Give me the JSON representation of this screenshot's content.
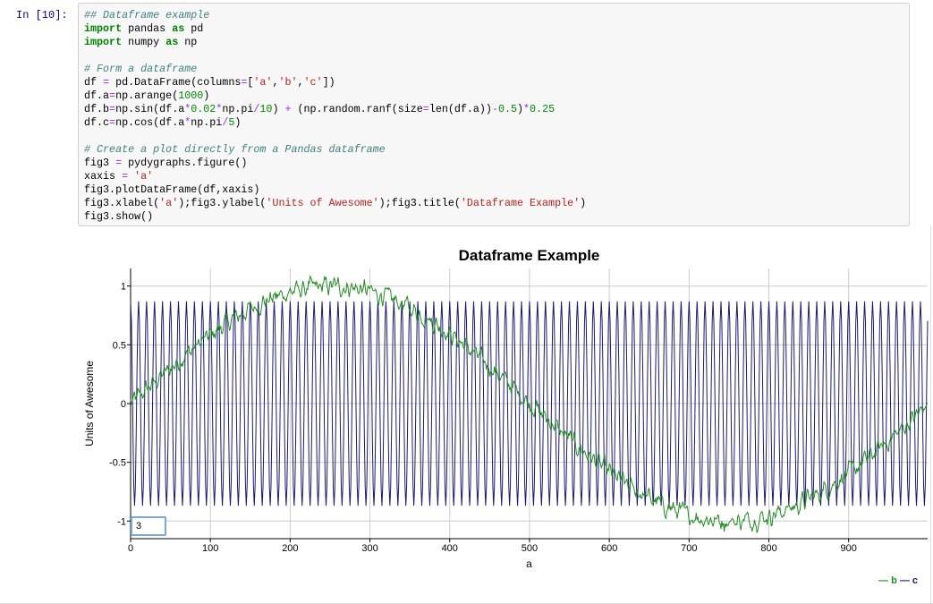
{
  "cell": {
    "prompt": "In [10]:",
    "code_lines": [
      [
        {
          "t": "## Dataframe example",
          "c": "comment"
        }
      ],
      [
        {
          "t": "import",
          "c": "kw"
        },
        {
          "t": " pandas ",
          "c": ""
        },
        {
          "t": "as",
          "c": "kw"
        },
        {
          "t": " pd",
          "c": ""
        }
      ],
      [
        {
          "t": "import",
          "c": "kw"
        },
        {
          "t": " numpy ",
          "c": ""
        },
        {
          "t": "as",
          "c": "kw"
        },
        {
          "t": " np",
          "c": ""
        }
      ],
      [
        {
          "t": "",
          "c": ""
        }
      ],
      [
        {
          "t": "# Form a dataframe",
          "c": "comment"
        }
      ],
      [
        {
          "t": "df ",
          "c": ""
        },
        {
          "t": "=",
          "c": "op"
        },
        {
          "t": " pd.DataFrame(columns",
          "c": ""
        },
        {
          "t": "=",
          "c": "op"
        },
        {
          "t": "[",
          "c": ""
        },
        {
          "t": "'a'",
          "c": "str"
        },
        {
          "t": ",",
          "c": ""
        },
        {
          "t": "'b'",
          "c": "str"
        },
        {
          "t": ",",
          "c": ""
        },
        {
          "t": "'c'",
          "c": "str"
        },
        {
          "t": "])",
          "c": ""
        }
      ],
      [
        {
          "t": "df.a",
          "c": ""
        },
        {
          "t": "=",
          "c": "op"
        },
        {
          "t": "np.arange(",
          "c": ""
        },
        {
          "t": "1000",
          "c": "num"
        },
        {
          "t": ")",
          "c": ""
        }
      ],
      [
        {
          "t": "df.b",
          "c": ""
        },
        {
          "t": "=",
          "c": "op"
        },
        {
          "t": "np.sin(df.a",
          "c": ""
        },
        {
          "t": "*",
          "c": "op"
        },
        {
          "t": "0.02",
          "c": "num"
        },
        {
          "t": "*",
          "c": "op"
        },
        {
          "t": "np.pi",
          "c": ""
        },
        {
          "t": "/",
          "c": "op"
        },
        {
          "t": "10",
          "c": "num"
        },
        {
          "t": ") ",
          "c": ""
        },
        {
          "t": "+",
          "c": "op"
        },
        {
          "t": " (np.random.ranf(size",
          "c": ""
        },
        {
          "t": "=",
          "c": "op"
        },
        {
          "t": "len(df.a))",
          "c": ""
        },
        {
          "t": "-",
          "c": "op"
        },
        {
          "t": "0.5",
          "c": "num"
        },
        {
          "t": ")",
          "c": ""
        },
        {
          "t": "*",
          "c": "op"
        },
        {
          "t": "0.25",
          "c": "num"
        }
      ],
      [
        {
          "t": "df.c",
          "c": ""
        },
        {
          "t": "=",
          "c": "op"
        },
        {
          "t": "np.cos(df.a",
          "c": ""
        },
        {
          "t": "*",
          "c": "op"
        },
        {
          "t": "np.pi",
          "c": ""
        },
        {
          "t": "/",
          "c": "op"
        },
        {
          "t": "5",
          "c": "num"
        },
        {
          "t": ")",
          "c": ""
        }
      ],
      [
        {
          "t": "",
          "c": ""
        }
      ],
      [
        {
          "t": "# Create a plot directly from a Pandas dataframe",
          "c": "comment"
        }
      ],
      [
        {
          "t": "fig3 ",
          "c": ""
        },
        {
          "t": "=",
          "c": "op"
        },
        {
          "t": " pydygraphs.figure()",
          "c": ""
        }
      ],
      [
        {
          "t": "xaxis ",
          "c": ""
        },
        {
          "t": "=",
          "c": "op"
        },
        {
          "t": " ",
          "c": ""
        },
        {
          "t": "'a'",
          "c": "str"
        }
      ],
      [
        {
          "t": "fig3.plotDataFrame(df,xaxis)",
          "c": ""
        }
      ],
      [
        {
          "t": "fig3.xlabel(",
          "c": ""
        },
        {
          "t": "'a'",
          "c": "str"
        },
        {
          "t": ");fig3.ylabel(",
          "c": ""
        },
        {
          "t": "'Units of Awesome'",
          "c": "str"
        },
        {
          "t": ");fig3.title(",
          "c": ""
        },
        {
          "t": "'Dataframe Example'",
          "c": "str"
        },
        {
          "t": ")",
          "c": ""
        }
      ],
      [
        {
          "t": "fig3.show()",
          "c": ""
        }
      ]
    ]
  },
  "roll_period_value": "3",
  "colors": {
    "series_b": "#228b22",
    "series_c": "#191970",
    "grid": "#cccccc"
  },
  "chart_data": {
    "type": "line",
    "title": "Dataframe Example",
    "xlabel": "a",
    "ylabel": "Units of Awesome",
    "xlim": [
      0,
      999
    ],
    "ylim": [
      -1.15,
      1.15
    ],
    "xticks": [
      0,
      100,
      200,
      300,
      400,
      500,
      600,
      700,
      800,
      900
    ],
    "yticks": [
      -1,
      -0.5,
      0,
      0.5,
      1
    ],
    "ytick_labels": [
      "-1",
      "-0.5",
      "0",
      "0.5",
      "1"
    ],
    "grid": true,
    "legend_position": "bottom-right",
    "series": [
      {
        "name": "b",
        "formula": "sin(a*0.02*pi/10) + noise(±0.125)",
        "amplitude": 1.0,
        "period": 1000,
        "noise": 0.25
      },
      {
        "name": "c",
        "formula": "cos(a*pi/5)",
        "amplitude": 0.87,
        "period": 10
      }
    ]
  }
}
